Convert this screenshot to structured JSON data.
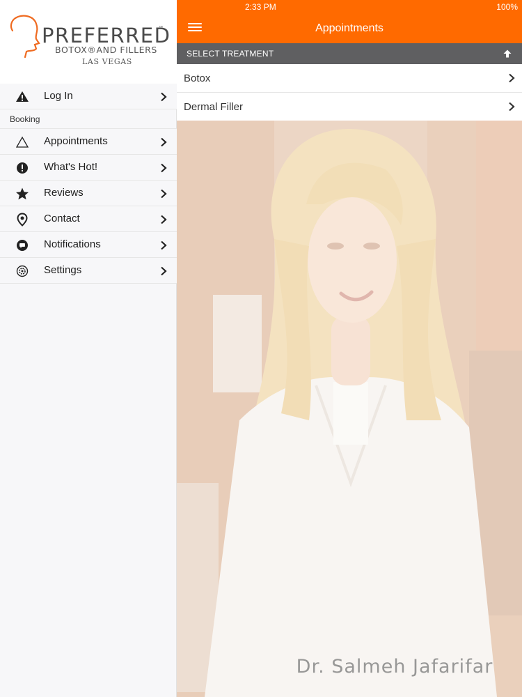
{
  "status_bar": {
    "time": "2:33 PM",
    "battery": "100%"
  },
  "nav": {
    "title": "Appointments",
    "menu_icon": "hamburger-menu-icon"
  },
  "logo": {
    "title": "PREFERRED",
    "tm": "™",
    "subtitle": "BOTOX®AND FILLERS",
    "city": "LAS VEGAS"
  },
  "sidebar": {
    "login": {
      "label": "Log In",
      "icon": "warning-icon"
    },
    "section_label": "Booking",
    "items": [
      {
        "label": "Appointments",
        "icon": "triangle-icon"
      },
      {
        "label": "What's Hot!",
        "icon": "exclamation-circle-icon"
      },
      {
        "label": "Reviews",
        "icon": "star-icon"
      },
      {
        "label": "Contact",
        "icon": "location-pin-icon"
      },
      {
        "label": "Notifications",
        "icon": "chat-bubble-icon"
      },
      {
        "label": "Settings",
        "icon": "gear-icon"
      }
    ]
  },
  "treatment": {
    "header": "SELECT TREATMENT",
    "collapse_icon": "arrow-up-icon",
    "options": [
      {
        "label": "Botox"
      },
      {
        "label": "Dermal Filler"
      }
    ]
  },
  "photo": {
    "caption": "Dr. Salmeh Jafarifar"
  },
  "colors": {
    "accent": "#ff6a00",
    "header_gray": "#5f5f61",
    "sidebar_bg": "#f7f7f9"
  }
}
